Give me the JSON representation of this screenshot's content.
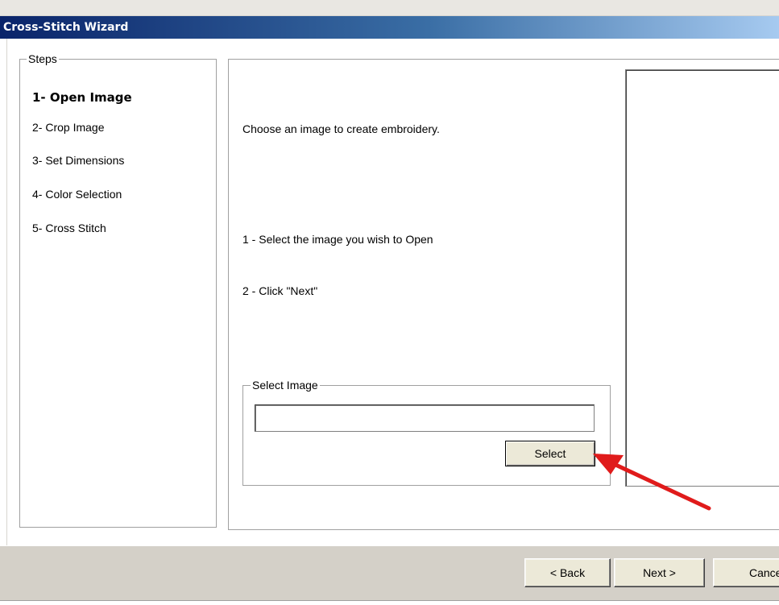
{
  "window": {
    "title": "Cross-Stitch Wizard"
  },
  "steps": {
    "legend": "Steps",
    "items": [
      {
        "label": "1- Open Image",
        "active": true
      },
      {
        "label": "2- Crop Image",
        "active": false
      },
      {
        "label": "3- Set Dimensions",
        "active": false
      },
      {
        "label": "4- Color Selection",
        "active": false
      },
      {
        "label": "5- Cross Stitch",
        "active": false
      }
    ]
  },
  "main": {
    "intro": "Choose an image to create embroidery.",
    "instructions": [
      "1 -   Select the image you wish to Open",
      "2 -   Click \"Next\""
    ],
    "select_group": {
      "legend": "Select Image",
      "path_value": "",
      "button_label": "Select"
    }
  },
  "footer": {
    "back_label": "< Back",
    "next_label": "Next >",
    "cancel_label": "Cancel"
  },
  "colors": {
    "title_bar_start": "#0a246a",
    "title_bar_end": "#a6caf0",
    "dialog_face": "#d4d0c8",
    "annotation_arrow": "#e01b1b"
  },
  "icons": {
    "annotation": "red-arrow-icon"
  }
}
